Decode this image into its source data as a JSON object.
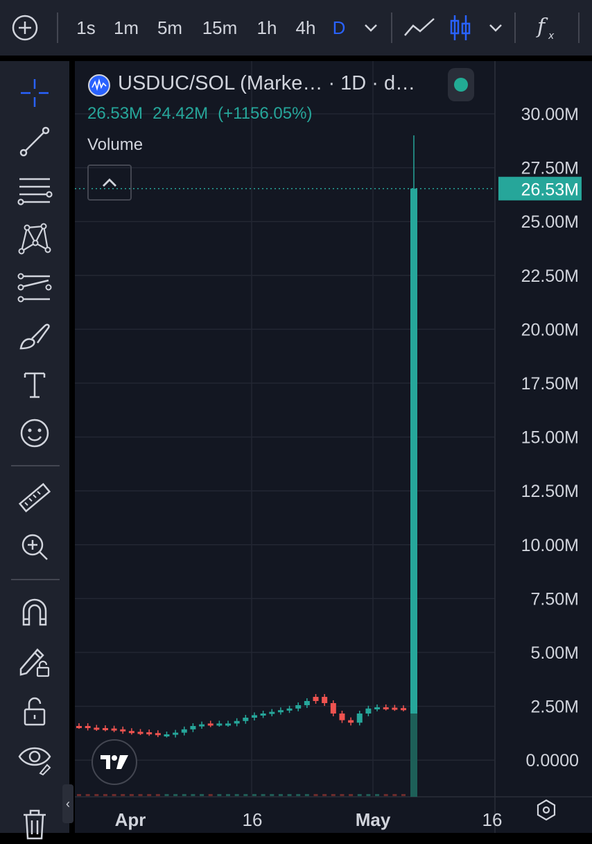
{
  "toolbar": {
    "intervals": [
      "1s",
      "1m",
      "5m",
      "15m",
      "1h",
      "4h",
      "D"
    ],
    "active_interval": "D",
    "accent_color": "#2962ff"
  },
  "left_tools": [
    "crosshair-icon",
    "trend-line-icon",
    "fib-retracement-icon",
    "pattern-icon",
    "forecast-icon",
    "brush-icon",
    "text-icon",
    "emoji-icon",
    "ruler-icon",
    "zoom-in-icon",
    "magnet-icon",
    "lock-drawing-icon",
    "unlock-icon",
    "eye-icon",
    "trash-icon"
  ],
  "legend": {
    "title": "USDUC/SOL (Marke…  · 1D · d…",
    "last_value": "26.53M",
    "change": "24.42M",
    "change_pct": "(+1156.05%)",
    "indicator_label": "Volume"
  },
  "colors": {
    "up": "#26a69a",
    "down": "#ef5350",
    "background": "#131722",
    "grid": "#232733"
  },
  "chart_data": {
    "type": "bar",
    "title": "Volume",
    "y_axis_ticks": [
      "30.00M",
      "27.50M",
      "25.00M",
      "22.50M",
      "20.00M",
      "17.50M",
      "15.00M",
      "12.50M",
      "10.00M",
      "7.50M",
      "5.00M",
      "2.50M",
      "0.0000"
    ],
    "ylim": [
      0,
      30000000
    ],
    "x_axis_ticks": [
      "Apr",
      "16",
      "May",
      "16"
    ],
    "last_value_label": "26.53M",
    "series": [
      {
        "values": [
          26530000
        ],
        "high": 29000000
      }
    ],
    "price_overlay": {
      "type": "candlestick",
      "values": [
        0.5,
        0.46,
        0.45,
        0.44,
        0.42,
        0.38,
        0.36,
        0.35,
        0.33,
        0.3,
        0.29,
        0.34,
        0.42,
        0.5,
        0.54,
        0.56,
        0.55,
        0.56,
        0.62,
        0.7,
        0.76,
        0.8,
        0.84,
        0.88,
        0.92,
        1.0,
        1.1,
        1.2,
        1.05,
        0.8,
        0.64,
        0.58,
        0.8,
        0.92,
        0.95,
        0.94,
        0.93,
        0.92
      ],
      "colors": [
        "down",
        "down",
        "down",
        "down",
        "down",
        "down",
        "down",
        "down",
        "down",
        "down",
        "up",
        "up",
        "up",
        "up",
        "up",
        "down",
        "up",
        "up",
        "up",
        "up",
        "up",
        "up",
        "up",
        "up",
        "up",
        "up",
        "up",
        "down",
        "down",
        "down",
        "down",
        "down",
        "up",
        "up",
        "up",
        "down",
        "down",
        "down"
      ]
    }
  }
}
